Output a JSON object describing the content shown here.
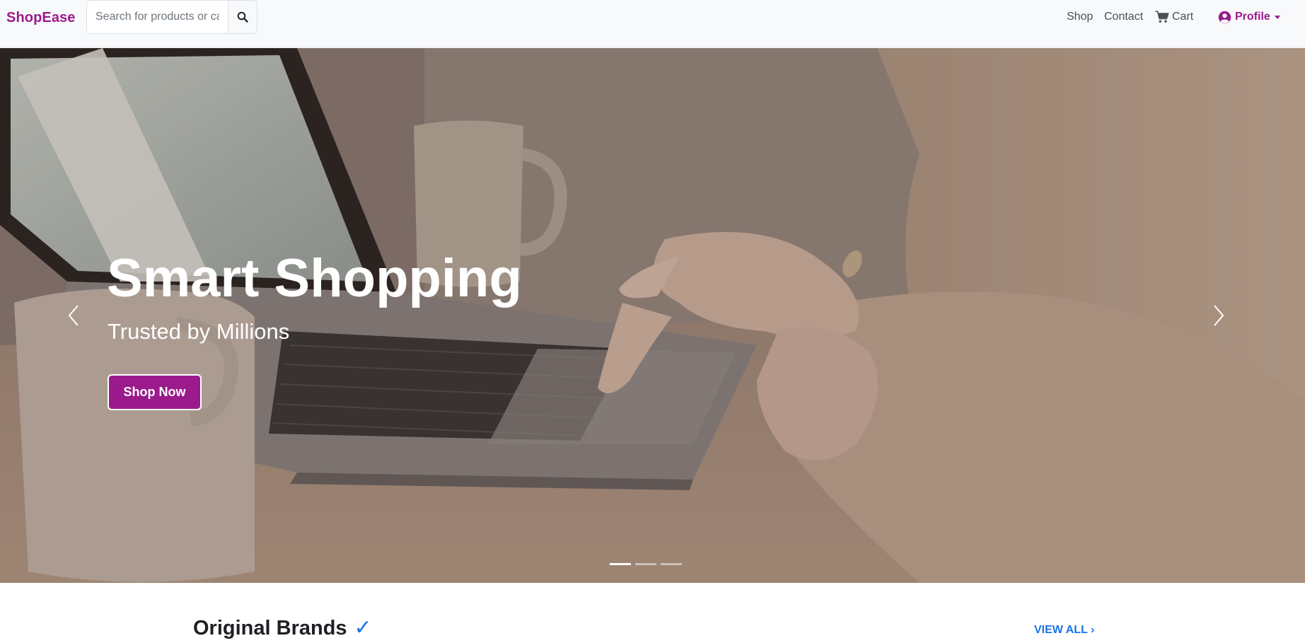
{
  "navbar": {
    "brand": "ShopEase",
    "search_placeholder": "Search for products or categories",
    "links": {
      "shop": "Shop",
      "contact": "Contact",
      "cart": "Cart",
      "profile": "Profile"
    }
  },
  "hero": {
    "title": "Smart Shopping",
    "subtitle": "Trusted by Millions",
    "cta_label": "Shop Now",
    "slide_count": 3,
    "active_slide": 1
  },
  "section": {
    "title": "Original Brands",
    "check_glyph": "✓",
    "view_all": "VIEW ALL ›"
  },
  "colors": {
    "brand": "#9b1b8c",
    "link_accent": "#1a73e8"
  },
  "icons": {
    "search": "search-icon",
    "cart": "cart-icon",
    "profile": "user-circle-icon",
    "prev": "chevron-left-icon",
    "next": "chevron-right-icon"
  }
}
